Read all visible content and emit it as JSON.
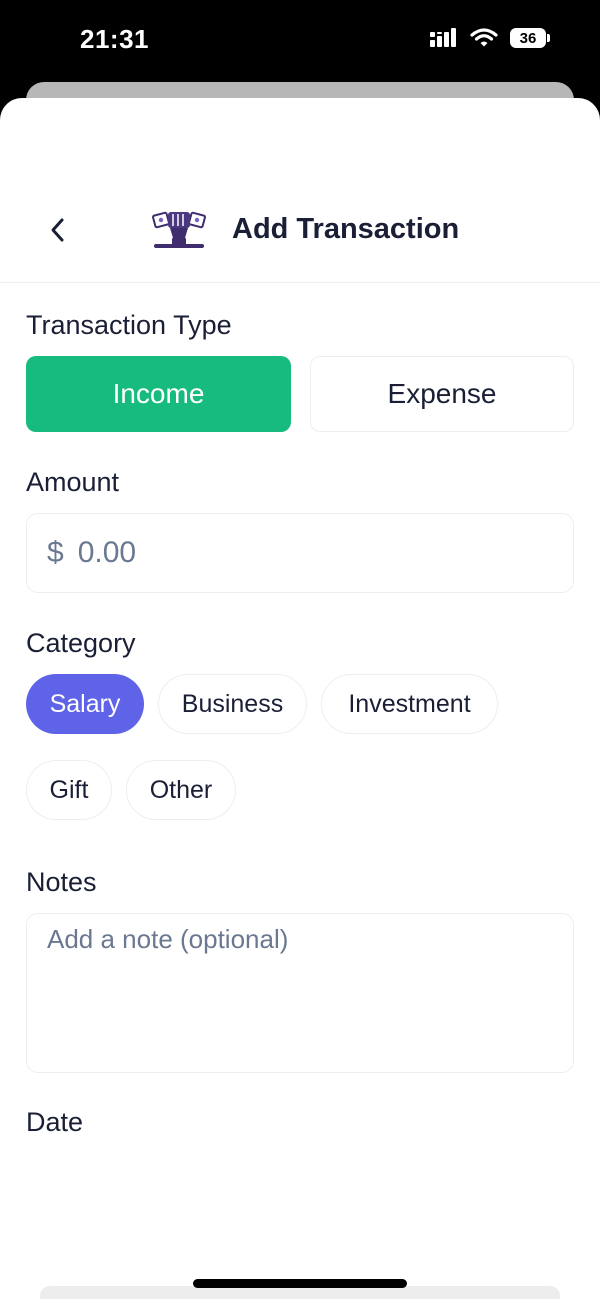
{
  "status_bar": {
    "time": "21:31",
    "battery_level": "36",
    "signal_icon": "cellular-signal-icon",
    "wifi_icon": "wifi-icon"
  },
  "header": {
    "title": "Add Transaction",
    "back_icon": "chevron-left-icon",
    "logo_icon": "money-fist-logo-icon"
  },
  "transaction_type": {
    "label": "Transaction Type",
    "options": [
      {
        "label": "Income",
        "selected": true
      },
      {
        "label": "Expense",
        "selected": false
      }
    ],
    "selected_color": "#16bb7d"
  },
  "amount": {
    "label": "Amount",
    "currency_symbol": "$",
    "placeholder": "0.00",
    "value": ""
  },
  "category": {
    "label": "Category",
    "chips": [
      {
        "label": "Salary",
        "selected": true
      },
      {
        "label": "Business",
        "selected": false
      },
      {
        "label": "Investment",
        "selected": false
      },
      {
        "label": "Gift",
        "selected": false
      },
      {
        "label": "Other",
        "selected": false
      }
    ],
    "selected_color": "#5f63e7"
  },
  "notes": {
    "label": "Notes",
    "placeholder": "Add a note (optional)",
    "value": ""
  },
  "date": {
    "label": "Date"
  }
}
